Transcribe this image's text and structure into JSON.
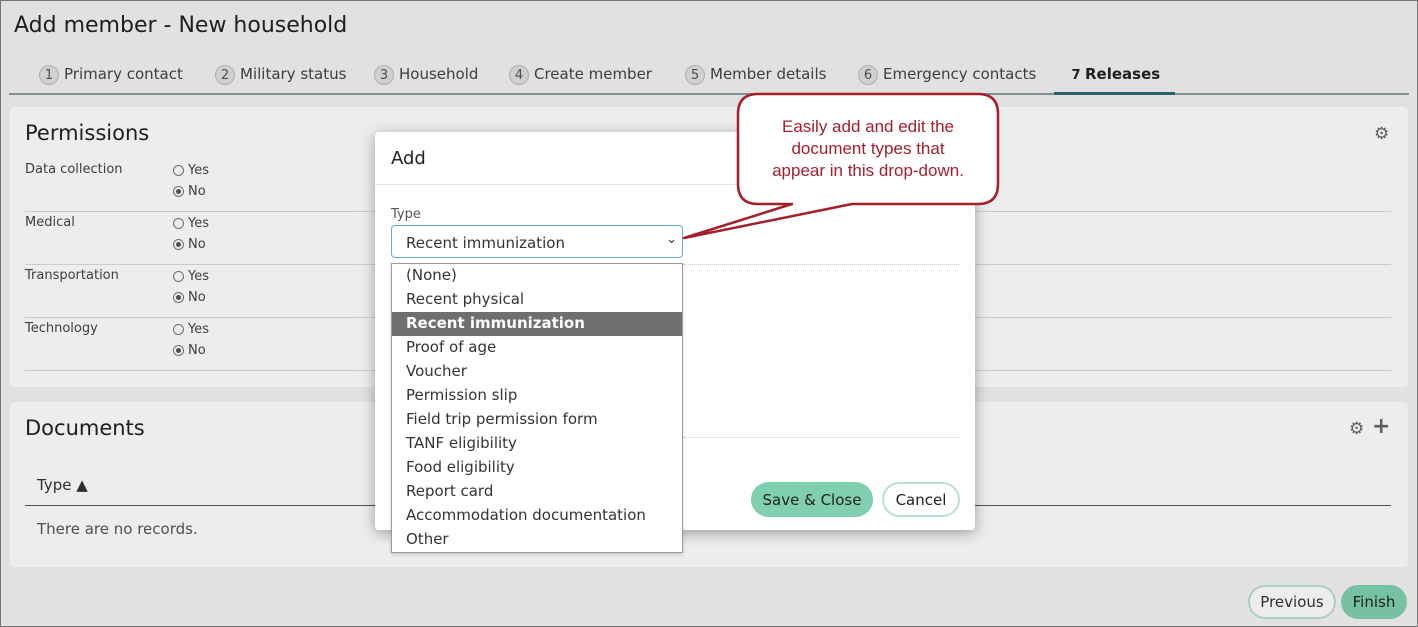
{
  "page": {
    "title": "Add member - New household"
  },
  "tabs": [
    {
      "num": "1",
      "label": "Primary contact"
    },
    {
      "num": "2",
      "label": "Military status"
    },
    {
      "num": "3",
      "label": "Household"
    },
    {
      "num": "4",
      "label": "Create member"
    },
    {
      "num": "5",
      "label": "Member details"
    },
    {
      "num": "6",
      "label": "Emergency contacts"
    },
    {
      "num": "7",
      "label": "Releases"
    }
  ],
  "active_tab": "Releases",
  "permissions": {
    "title": "Permissions",
    "yes_label": "Yes",
    "no_label": "No",
    "rows": [
      {
        "label": "Data collection",
        "value": "No"
      },
      {
        "label": "Medical",
        "value": "No"
      },
      {
        "label": "Transportation",
        "value": "No"
      },
      {
        "label": "Technology",
        "value": "No"
      }
    ]
  },
  "documents": {
    "title": "Documents",
    "column_type": "Type ▲",
    "empty_text": "There are no records."
  },
  "footer": {
    "previous": "Previous",
    "finish": "Finish"
  },
  "modal": {
    "title": "Add",
    "type_label": "Type",
    "type_value": "Recent immunization",
    "save_close": "Save & Close",
    "cancel": "Cancel"
  },
  "dropdown_options": [
    "(None)",
    "Recent physical",
    "Recent immunization",
    "Proof of age",
    "Voucher",
    "Permission slip",
    "Field trip permission form",
    "TANF eligibility",
    "Food eligibility",
    "Report card",
    "Accommodation documentation",
    "Other"
  ],
  "callout": {
    "line1": "Easily add and edit the",
    "line2": "document types that",
    "line3": "appear in this drop-down.",
    "color": "#a31f2b"
  },
  "colors": {
    "accent_green": "#7fcfb0",
    "tab_underline": "#2a6b74",
    "callout_red": "#a31f2b"
  },
  "icons": {
    "settings": "gear-icon",
    "add": "plus-icon",
    "dropdown": "chevron-down-icon"
  }
}
